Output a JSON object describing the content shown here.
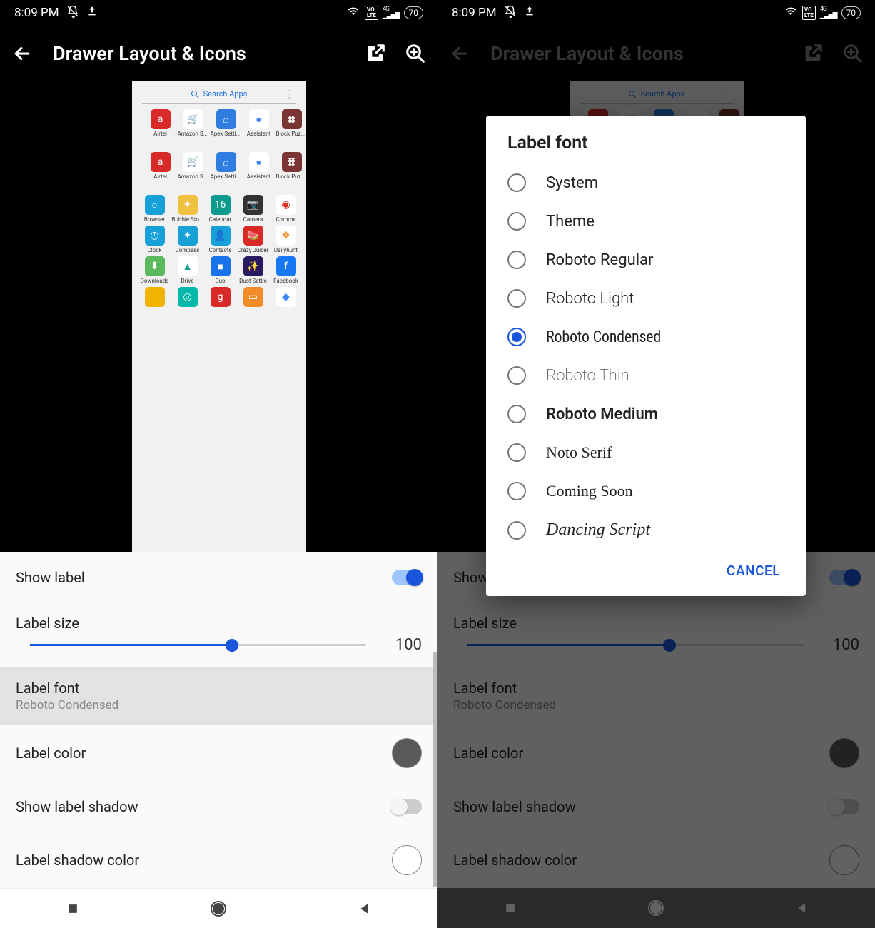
{
  "status": {
    "time": "8:09 PM",
    "battery": "70",
    "net": "4G",
    "volte": "VO\nLTE"
  },
  "appbar": {
    "title": "Drawer Layout & Icons"
  },
  "preview": {
    "search": "Search Apps",
    "row1": [
      {
        "label": "Airtel",
        "bg": "#d92a2a",
        "glyph": "a"
      },
      {
        "label": "Amazon Sh..",
        "bg": "#fff",
        "glyph": "🛒",
        "fg": "#111"
      },
      {
        "label": "Apex Settin..",
        "bg": "#2f7de1",
        "glyph": "⌂"
      },
      {
        "label": "Assistant",
        "bg": "#fff",
        "glyph": "●",
        "fg": "#4285f4"
      },
      {
        "label": "Block Puzzl..",
        "bg": "#7a3434",
        "glyph": "▦"
      }
    ],
    "row2": [
      {
        "label": "Airtel",
        "bg": "#d92a2a",
        "glyph": "a"
      },
      {
        "label": "Amazon Sh..",
        "bg": "#fff",
        "glyph": "🛒",
        "fg": "#111"
      },
      {
        "label": "Apex Settin..",
        "bg": "#2f7de1",
        "glyph": "⌂"
      },
      {
        "label": "Assistant",
        "bg": "#fff",
        "glyph": "●",
        "fg": "#4285f4"
      },
      {
        "label": "Block Puzzl..",
        "bg": "#7a3434",
        "glyph": "▦"
      }
    ],
    "row3": [
      {
        "label": "Browser",
        "bg": "#18a0d8",
        "glyph": "○"
      },
      {
        "label": "Bubble Story",
        "bg": "#f0c040",
        "glyph": "✦"
      },
      {
        "label": "Calendar",
        "bg": "#0a9b8e",
        "glyph": "16"
      },
      {
        "label": "Camera",
        "bg": "#333",
        "glyph": "📷"
      },
      {
        "label": "Chrome",
        "bg": "#fff",
        "glyph": "◉",
        "fg": "#d93025"
      }
    ],
    "row4": [
      {
        "label": "Clock",
        "bg": "#18a0d8",
        "glyph": "◷"
      },
      {
        "label": "Compass",
        "bg": "#18a0d8",
        "glyph": "✦"
      },
      {
        "label": "Contacts",
        "bg": "#18a0d8",
        "glyph": "👤"
      },
      {
        "label": "Crazy Juicer",
        "bg": "#d92a2a",
        "glyph": "🍉"
      },
      {
        "label": "Dailyhunt",
        "bg": "#fff",
        "glyph": "❖",
        "fg": "#f28c28"
      }
    ],
    "row5": [
      {
        "label": "Downloads",
        "bg": "#5cb85c",
        "glyph": "⬇"
      },
      {
        "label": "Drive",
        "bg": "#fff",
        "glyph": "▲",
        "fg": "#0a9b8e"
      },
      {
        "label": "Duo",
        "bg": "#1a73e8",
        "glyph": "■"
      },
      {
        "label": "Dust Settle",
        "bg": "#2a1a60",
        "glyph": "✨"
      },
      {
        "label": "Facebook",
        "bg": "#1877f2",
        "glyph": "f"
      }
    ],
    "row6": [
      {
        "label": "",
        "bg": "#f2b200",
        "glyph": ""
      },
      {
        "label": "",
        "bg": "#00b8a9",
        "glyph": "◎"
      },
      {
        "label": "",
        "bg": "#d92a2a",
        "glyph": "g"
      },
      {
        "label": "",
        "bg": "#f28c28",
        "glyph": "▭"
      },
      {
        "label": "",
        "bg": "#fff",
        "glyph": "◆",
        "fg": "#4285f4"
      }
    ]
  },
  "settings": {
    "show_label": "Show label",
    "label_size": "Label size",
    "label_size_value": "100",
    "label_font": "Label font",
    "label_font_value": "Roboto Condensed",
    "label_color": "Label color",
    "label_color_value": "#5a5a5a",
    "show_shadow": "Show label shadow",
    "shadow_color": "Label shadow color",
    "shadow_color_value": "#ffffff"
  },
  "dialog": {
    "title": "Label font",
    "options": [
      {
        "label": "System",
        "cls": ""
      },
      {
        "label": "Theme",
        "cls": ""
      },
      {
        "label": "Roboto Regular",
        "cls": ""
      },
      {
        "label": "Roboto Light",
        "cls": "font-light"
      },
      {
        "label": "Roboto Condensed",
        "cls": "font-cond",
        "selected": true
      },
      {
        "label": "Roboto Thin",
        "cls": "font-thin"
      },
      {
        "label": "Roboto Medium",
        "cls": "font-med"
      },
      {
        "label": "Noto Serif",
        "cls": "font-serif"
      },
      {
        "label": "Coming Soon",
        "cls": "font-coming"
      },
      {
        "label": "Dancing Script",
        "cls": "font-dancing"
      }
    ],
    "cancel": "CANCEL"
  }
}
